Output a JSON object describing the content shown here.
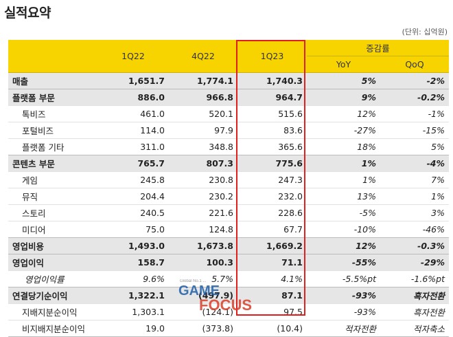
{
  "title": "실적요약",
  "unit_note": "(단위: 십억원)",
  "header": {
    "quarters": [
      "1Q22",
      "4Q22",
      "1Q23"
    ],
    "change_group": "증감률",
    "yoy": "YoY",
    "qoq": "QoQ"
  },
  "rows": [
    {
      "label": "매출",
      "kind": "major",
      "v": [
        "1,651.7",
        "1,774.1",
        "1,740.3"
      ],
      "yoy": "5%",
      "qoq": "-2%"
    },
    {
      "label": "플랫폼 부문",
      "kind": "major",
      "v": [
        "886.0",
        "966.8",
        "964.7"
      ],
      "yoy": "9%",
      "qoq": "-0.2%"
    },
    {
      "label": "톡비즈",
      "kind": "minor",
      "v": [
        "461.0",
        "520.1",
        "515.6"
      ],
      "yoy": "12%",
      "qoq": "-1%"
    },
    {
      "label": "포털비즈",
      "kind": "minor",
      "v": [
        "114.0",
        "97.9",
        "83.6"
      ],
      "yoy": "-27%",
      "qoq": "-15%"
    },
    {
      "label": "플랫폼 기타",
      "kind": "minor",
      "v": [
        "311.0",
        "348.8",
        "365.6"
      ],
      "yoy": "18%",
      "qoq": "5%"
    },
    {
      "label": "콘텐츠 부문",
      "kind": "major",
      "v": [
        "765.7",
        "807.3",
        "775.6"
      ],
      "yoy": "1%",
      "qoq": "-4%"
    },
    {
      "label": "게임",
      "kind": "minor",
      "v": [
        "245.8",
        "230.8",
        "247.3"
      ],
      "yoy": "1%",
      "qoq": "7%"
    },
    {
      "label": "뮤직",
      "kind": "minor",
      "v": [
        "204.4",
        "230.2",
        "232.0"
      ],
      "yoy": "13%",
      "qoq": "1%"
    },
    {
      "label": "스토리",
      "kind": "minor",
      "v": [
        "240.5",
        "221.6",
        "228.6"
      ],
      "yoy": "-5%",
      "qoq": "3%"
    },
    {
      "label": "미디어",
      "kind": "minor",
      "v": [
        "75.0",
        "124.8",
        "67.7"
      ],
      "yoy": "-10%",
      "qoq": "-46%"
    },
    {
      "label": "영업비용",
      "kind": "major",
      "v": [
        "1,493.0",
        "1,673.8",
        "1,669.2"
      ],
      "yoy": "12%",
      "qoq": "-0.3%"
    },
    {
      "label": "영업이익",
      "kind": "major",
      "v": [
        "158.7",
        "100.3",
        "71.1"
      ],
      "yoy": "-55%",
      "qoq": "-29%"
    },
    {
      "label": "영업이익률",
      "kind": "ratio",
      "v": [
        "9.6%",
        "5.7%",
        "4.1%"
      ],
      "yoy": "-5.5%pt",
      "qoq": "-1.6%pt"
    },
    {
      "label": "연결당기순이익",
      "kind": "major",
      "v": [
        "1,322.1",
        "(497.9)",
        "87.1"
      ],
      "yoy": "-93%",
      "qoq": "흑자전환"
    },
    {
      "label": "지배지분순이익",
      "kind": "minor",
      "v": [
        "1,303.1",
        "(124.1)",
        "97.5"
      ],
      "yoy": "-93%",
      "qoq": "흑자전환"
    },
    {
      "label": "비지배지분순이익",
      "kind": "minor",
      "v": [
        "19.0",
        "(373.8)",
        "(10.4)"
      ],
      "yoy": "적자전환",
      "qoq": "적자축소"
    }
  ],
  "watermark": {
    "top_text": "Global No.1 ...",
    "word_top": "GAME",
    "word_bottom": "FOCUS",
    "colors": {
      "game": "#1f5fa8",
      "focus": "#d8402a"
    }
  },
  "colors": {
    "header_bg": "#f7d400",
    "major_row_bg": "#e6e6e6",
    "highlight_border": "#e01e1e"
  }
}
